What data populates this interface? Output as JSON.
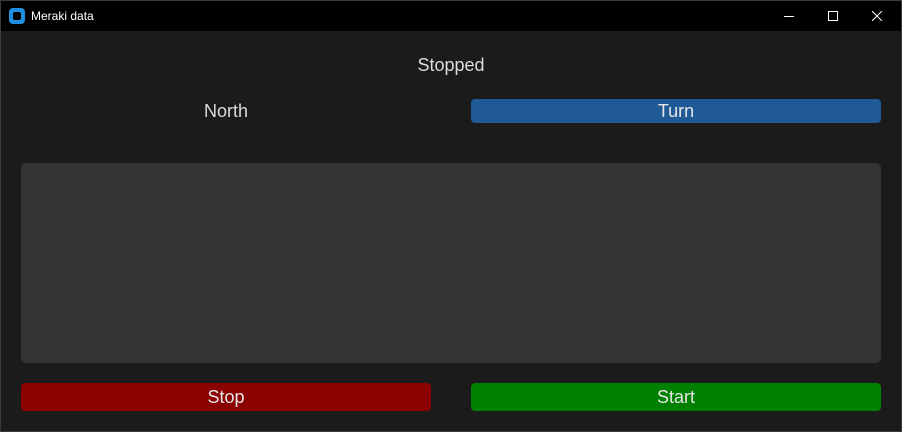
{
  "window": {
    "title": "Meraki data",
    "app_icon": "meraki-app-icon",
    "controls": {
      "minimize_icon": "minimize-icon",
      "maximize_icon": "maximize-icon",
      "close_icon": "close-icon"
    }
  },
  "main": {
    "status_text": "Stopped",
    "direction_text": "North",
    "turn_label": "Turn",
    "output_text": "",
    "stop_label": "Stop",
    "start_label": "Start"
  },
  "colors": {
    "background": "#1b1b1b",
    "turn_button": "#1f5a96",
    "stop_button": "#8b0000",
    "start_button": "#008000",
    "textbox": "#333333"
  }
}
